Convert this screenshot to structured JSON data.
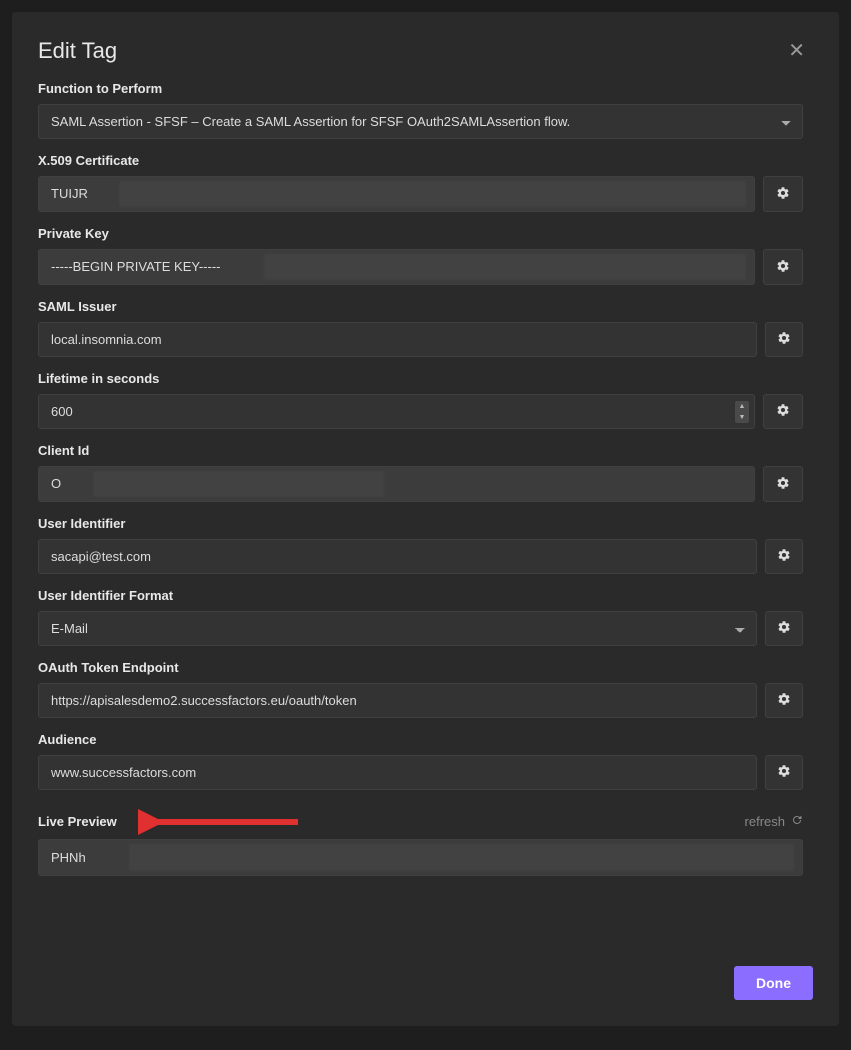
{
  "modal": {
    "title": "Edit Tag"
  },
  "fields": {
    "function": {
      "label": "Function to Perform",
      "value": "SAML Assertion - SFSF – Create a SAML Assertion for SFSF OAuth2SAMLAssertion flow."
    },
    "x509": {
      "label": "X.509 Certificate",
      "value": "TUIJR"
    },
    "private_key": {
      "label": "Private Key",
      "value": "-----BEGIN PRIVATE KEY-----"
    },
    "saml_issuer": {
      "label": "SAML Issuer",
      "value": "local.insomnia.com"
    },
    "lifetime": {
      "label": "Lifetime in seconds",
      "value": "600"
    },
    "client_id": {
      "label": "Client Id",
      "value": "O"
    },
    "user_identifier": {
      "label": "User Identifier",
      "value": "sacapi@test.com"
    },
    "user_identifier_format": {
      "label": "User Identifier Format",
      "value": "E-Mail"
    },
    "oauth_token_endpoint": {
      "label": "OAuth Token Endpoint",
      "value": "https://apisalesdemo2.successfactors.eu/oauth/token"
    },
    "audience": {
      "label": "Audience",
      "value": "www.successfactors.com"
    }
  },
  "preview": {
    "title": "Live Preview",
    "refresh_label": "refresh",
    "value": "PHNh"
  },
  "footer": {
    "done_label": "Done"
  }
}
